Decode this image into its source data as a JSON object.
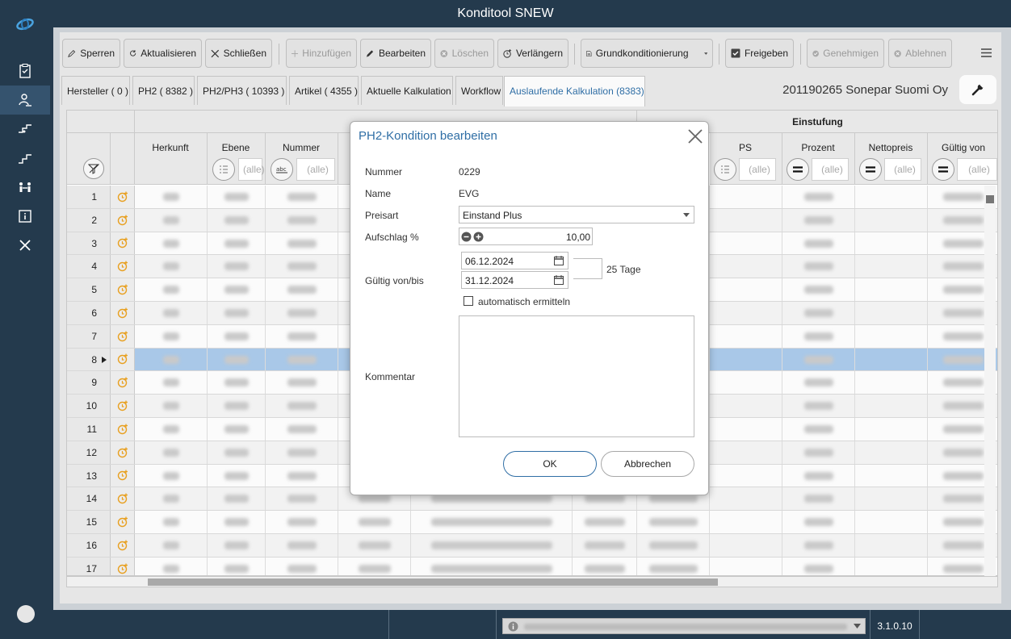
{
  "app": {
    "title": "Konditool SNEW",
    "version": "3.1.0.10"
  },
  "nav": {
    "icons": [
      "logo-icon",
      "clipboard-icon",
      "person-sign-icon",
      "price-step-icon",
      "stairs-icon",
      "people-icon",
      "info-icon",
      "tools-icon"
    ]
  },
  "toolbar": {
    "sperren": "Sperren",
    "aktualisieren": "Aktualisieren",
    "schliessen": "Schließen",
    "hinzufuegen": "Hinzufügen",
    "bearbeiten": "Bearbeiten",
    "loeschen": "Löschen",
    "verlaengern": "Verlängern",
    "grundkonditionierung": "Grundkonditionierung",
    "freigeben": "Freigeben",
    "genehmigen": "Genehmigen",
    "ablehnen": "Ablehnen"
  },
  "tabs": [
    {
      "label": "Hersteller ( 0 )"
    },
    {
      "label": "PH2 ( 8382 )"
    },
    {
      "label": "PH2/PH3 ( 10393 )"
    },
    {
      "label": "Artikel ( 4355 )"
    },
    {
      "label": "Aktuelle Kalkulation"
    },
    {
      "label": "Workflow"
    },
    {
      "label": "Auslaufende Kalkulation (8383)"
    }
  ],
  "customer": "201190265 Sonepar Suomi Oy",
  "grid": {
    "group_headers": {
      "einstufung": "Einstufung"
    },
    "columns": {
      "herkunft": "Herkunft",
      "ebene": "Ebene",
      "nummer": "Nummer",
      "ps": "PS",
      "prozent": "Prozent",
      "nettopreis": "Nettopreis",
      "gueltig_von": "Gültig von"
    },
    "filter_placeholder": "(alle)",
    "rows": [
      "1",
      "2",
      "3",
      "4",
      "5",
      "6",
      "7",
      "8",
      "9",
      "10",
      "11",
      "12",
      "13",
      "14",
      "15",
      "16",
      "17"
    ],
    "selected_row": "8"
  },
  "dialog": {
    "title": "PH2-Kondition bearbeiten",
    "nummer_label": "Nummer",
    "nummer": "0229",
    "name_label": "Name",
    "name": "EVG",
    "preisart_label": "Preisart",
    "preisart": "Einstand Plus",
    "aufschlag_label": "Aufschlag %",
    "aufschlag": "10,00",
    "gueltig_label": "Gültig von/bis",
    "von": "06.12.2024",
    "bis": "31.12.2024",
    "tage": "25 Tage",
    "auto_label": "automatisch ermitteln",
    "kommentar_label": "Kommentar",
    "ok": "OK",
    "abbrechen": "Abbrechen"
  },
  "colors": {
    "accent": "#2f6ea5",
    "selected_row": "#a9c8e8",
    "nav_bg": "#243a4d",
    "orange_icon": "#e8a020"
  }
}
